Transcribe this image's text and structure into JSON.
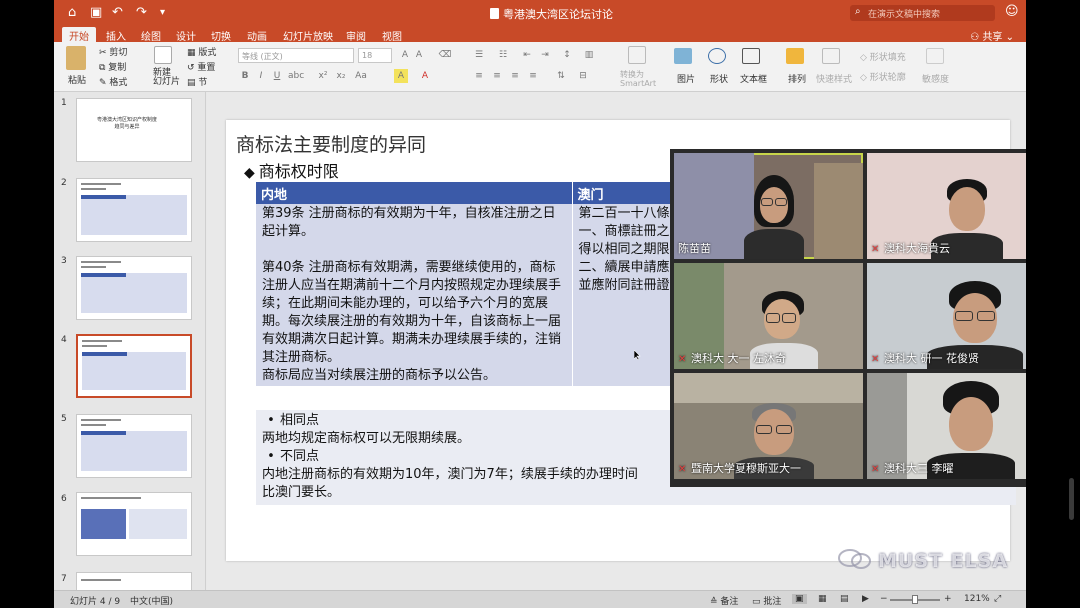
{
  "window": {
    "title": "粤港澳大湾区论坛讨论",
    "search_placeholder": "在演示文稿中搜索"
  },
  "tabs": [
    "开始",
    "插入",
    "绘图",
    "设计",
    "切换",
    "动画",
    "幻灯片放映",
    "审阅",
    "视图"
  ],
  "share_label": "共享",
  "ribbon": {
    "paste": "粘贴",
    "cut": "剪切",
    "copy": "复制",
    "format": "格式",
    "new_slide": "新建\n幻灯片",
    "layout": "版式",
    "reset": "重置",
    "section": "节",
    "font_name": "等线 (正文)",
    "font_size": "18",
    "convert_smartart": "转换为\nSmartArt",
    "picture": "图片",
    "shape": "形状",
    "textbox": "文本框",
    "arrange": "排列",
    "quick_styles": "快速样式",
    "shape_fill": "形状填充",
    "shape_outline": "形状轮廓",
    "sensitivity": "敏感度"
  },
  "thumbnails": [
    {
      "num": "1",
      "title": "粤港澳大湾区知识产权制度\n趋同与差异"
    },
    {
      "num": "2"
    },
    {
      "num": "3"
    },
    {
      "num": "4",
      "selected": true
    },
    {
      "num": "5"
    },
    {
      "num": "6"
    },
    {
      "num": "7"
    }
  ],
  "slide": {
    "title": "商标法主要制度的异同",
    "subtitle": "商标权时限",
    "table": {
      "headers": [
        "内地",
        "澳门"
      ],
      "mainland": [
        "第39条 注册商标的有效期为十年，自核准注册之日起计算。",
        "",
        "第40条 注册商标有效期满，需要继续使用的，商标注册人应当在期满前十二个月内按照规定办理续展手续；在此期间未能办理的，可以给予六个月的宽展期。每次续展注册的有效期为十年，自该商标上一届有效期满次日起计算。期满未办理续展手续的，注销其注册商标。",
        "商标局应当对续展注册的商标予以公告。"
      ],
      "macau": [
        "第二百一十八條",
        "一、商標註冊之",
        "得以相同之期限",
        "二、續展申請應",
        "並應附同註冊證"
      ]
    },
    "notes": {
      "same_label": "相同点",
      "same_text": "两地均规定商标权可以无限期续展。",
      "diff_label": "不同点",
      "diff_text": "内地注册商标的有效期为10年，澳门为7年；续展手续的办理时间",
      "diff_text2": "比澳门要长。"
    }
  },
  "status": {
    "slide_info": "幻灯片 4 / 9",
    "language": "中文(中国)",
    "notes": "备注",
    "comments": "批注",
    "zoom": "121%"
  },
  "participants": [
    {
      "name": "陈苗苗",
      "muted": false
    },
    {
      "name": "澳科大海貴云",
      "muted": true
    },
    {
      "name": "澳科大 大一 左沐奇",
      "muted": true
    },
    {
      "name": "澳科大 研一 花俊贤",
      "muted": true
    },
    {
      "name": "暨南大学夏穆斯亚大一",
      "muted": true
    },
    {
      "name": "澳科大三  李曜",
      "muted": true
    }
  ],
  "watermark": "MUST ELSA",
  "colors": {
    "accent": "#c84a28",
    "table_header": "#3b5aa8",
    "table_body": "#d4d8ea"
  }
}
